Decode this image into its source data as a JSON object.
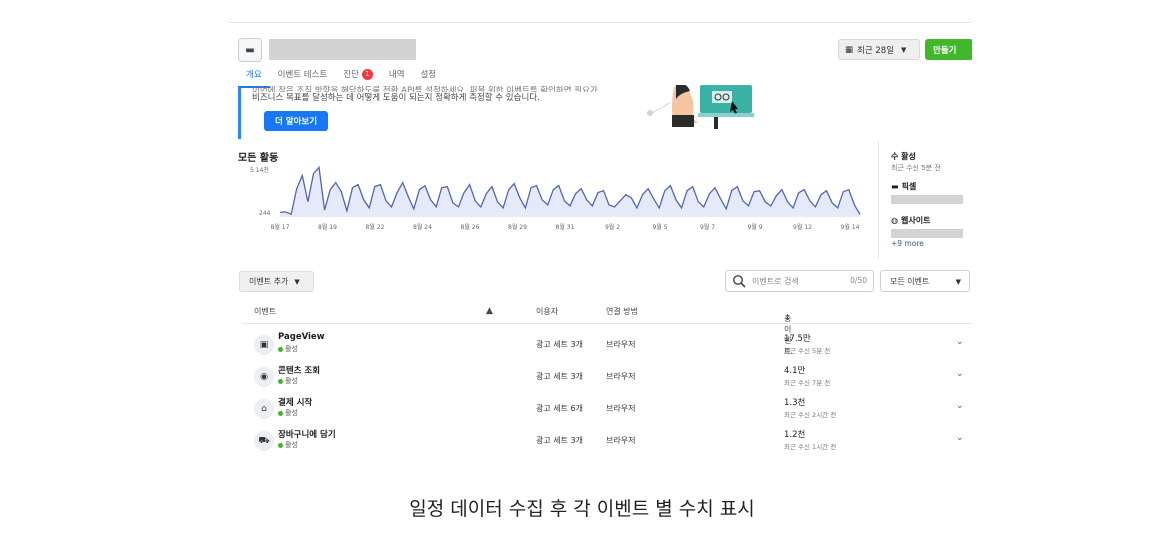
{
  "header": {
    "pixel_icon": "monitor-icon",
    "date_range_label": "최근 28일",
    "create_button_label": "만들기"
  },
  "tabs": [
    {
      "label": "개요",
      "active": true
    },
    {
      "label": "이벤트 테스트",
      "active": false
    },
    {
      "label": "진단",
      "active": false,
      "badge": "1"
    },
    {
      "label": "내역",
      "active": false
    },
    {
      "label": "설정",
      "active": false
    }
  ],
  "banner": {
    "line1": "이번에 작은 조직 방향을 해당하도록 전환 API를 설정하세요. 퍼블 위한 이벤트를 확인하면 필요가",
    "line2": "비즈니스 목표를 달성하는 데 어떻게 도움이 되는지 정확하게 측정할 수 있습니다.",
    "learn_more_label": "더 알아보기"
  },
  "chart_section": {
    "title": "모든 활동"
  },
  "chart_data": {
    "type": "area",
    "title": "모든 활동",
    "y_tick_labels": [
      "5.14천",
      "244"
    ],
    "ylim": [
      0,
      5140
    ],
    "x_tick_labels": [
      "8월 17",
      "8월 19",
      "8월 22",
      "8월 24",
      "8월 26",
      "8월 29",
      "8월 31",
      "9월 2",
      "9월 5",
      "9월 7",
      "9월 9",
      "9월 12",
      "9월 14"
    ],
    "series": [
      {
        "values": [
          450,
          500,
          280,
          2800,
          4100,
          1500,
          4300,
          4900,
          700,
          2700,
          3400,
          2500,
          600,
          2900,
          3200,
          1700,
          900,
          3000,
          3200,
          1600,
          1000,
          2400,
          3400,
          2000,
          800,
          2700,
          3100,
          1700,
          1000,
          2900,
          3000,
          1400,
          1000,
          2400,
          3200,
          1600,
          1000,
          2300,
          3000,
          1500,
          900,
          2700,
          3300,
          1900,
          900,
          2900,
          3100,
          1700,
          1200,
          2700,
          3100,
          1600,
          1100,
          2300,
          2800,
          1700,
          1100,
          2400,
          2600,
          1200,
          1000,
          1600,
          2200,
          1900,
          900,
          2200,
          2800,
          1800,
          900,
          2600,
          3100,
          1700,
          900,
          2600,
          3000,
          1500,
          1000,
          2300,
          2900,
          1800,
          800,
          2600,
          3000,
          1600,
          1100,
          2500,
          2600,
          1500,
          1100,
          2100,
          2700,
          1500,
          900,
          2400,
          2700,
          1600,
          1000,
          2200,
          2600,
          1400,
          900,
          2500,
          2700,
          1200,
          250
        ]
      }
    ],
    "colors": {
      "line": "#5464b4",
      "fill": "#e6e9f7"
    }
  },
  "side_panel": {
    "title": "수 활성",
    "subtitle": "최근 수신 5분 전",
    "pixel_label": "픽셀",
    "website_label": "웹사이트",
    "more_link": "+9 more"
  },
  "controls": {
    "add_event_label": "이벤트 추가",
    "search_placeholder": "이벤트로 검색",
    "search_count": "0/50",
    "filter_label": "모든 이벤트"
  },
  "table": {
    "headers": {
      "event": "이벤트",
      "users": "이용자",
      "connection": "연결 방법",
      "total": "총 이벤트"
    },
    "rows": [
      {
        "icon": "calendar-icon",
        "glyph": "▣",
        "name": "PageView",
        "status": "활성",
        "users": "광고 세트 3개",
        "connection": "브라우저",
        "total": "17.5만",
        "received": "최근 수신 5분 전"
      },
      {
        "icon": "eye-icon",
        "glyph": "◉",
        "name": "콘텐츠 조회",
        "status": "활성",
        "users": "광고 세트 3개",
        "connection": "브라우저",
        "total": "4.1만",
        "received": "최근 수신 7분 전"
      },
      {
        "icon": "basket-icon",
        "glyph": "⌂",
        "name": "결제 시작",
        "status": "활성",
        "users": "광고 세트 6개",
        "connection": "브라우저",
        "total": "1.3천",
        "received": "최근 수신 2시간 전"
      },
      {
        "icon": "cart-icon",
        "glyph": "⛟",
        "name": "장바구니에 담기",
        "status": "활성",
        "users": "광고 세트 3개",
        "connection": "브라우저",
        "total": "1.2천",
        "received": "최근 수신 1시간 전"
      }
    ]
  },
  "caption": "일정 데이터 수집 후 각 이벤트 별 수치 표시"
}
